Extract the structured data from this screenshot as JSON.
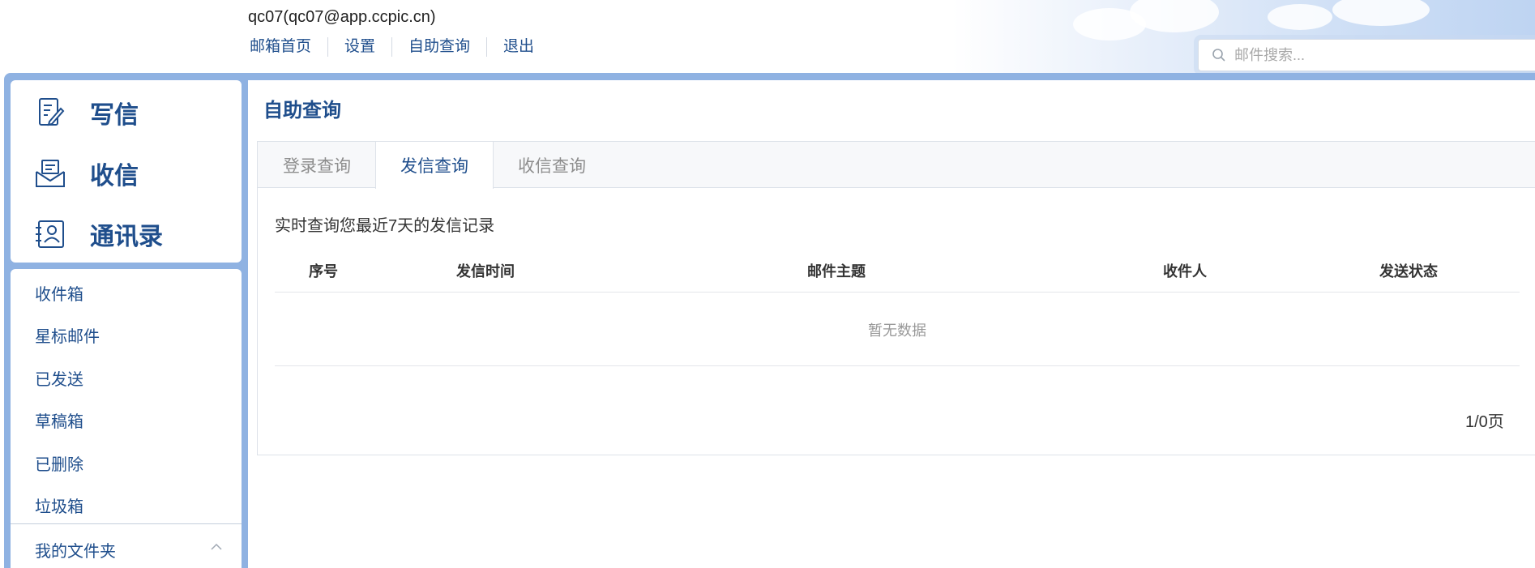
{
  "header": {
    "account": "qc07(qc07@app.ccpic.cn)",
    "nav": [
      "邮箱首页",
      "设置",
      "自助查询",
      "退出"
    ],
    "search_placeholder": "邮件搜索..."
  },
  "sidebar": {
    "quick": [
      {
        "label": "写信",
        "icon": "compose-icon"
      },
      {
        "label": "收信",
        "icon": "inbox-tray-icon"
      },
      {
        "label": "通讯录",
        "icon": "contacts-icon"
      }
    ],
    "folders": [
      "收件箱",
      "星标邮件",
      "已发送",
      "草稿箱",
      "已删除",
      "垃圾箱"
    ],
    "my_folders": "我的文件夹"
  },
  "main": {
    "title": "自助查询",
    "tabs": [
      {
        "label": "登录查询",
        "active": false
      },
      {
        "label": "发信查询",
        "active": true
      },
      {
        "label": "收信查询",
        "active": false
      }
    ],
    "description": "实时查询您最近7天的发信记录",
    "columns": [
      "序号",
      "发信时间",
      "邮件主题",
      "收件人",
      "发送状态"
    ],
    "empty_text": "暂无数据",
    "pager": "1/0页"
  },
  "colors": {
    "accent": "#1f4e8c",
    "frame": "#8fb2e2"
  }
}
